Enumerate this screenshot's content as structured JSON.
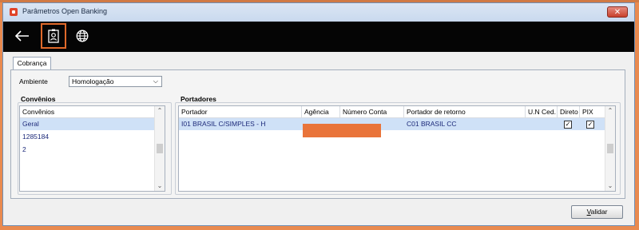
{
  "window": {
    "title": "Parâmetros Open Banking",
    "close_glyph": "✕"
  },
  "toolbar": {
    "buttons": [
      "arrow-left-icon",
      "contact-card-icon",
      "globe-icon"
    ]
  },
  "tabs": [
    {
      "label": "Cobrança"
    }
  ],
  "ambiente": {
    "label": "Ambiente",
    "value": "Homologação"
  },
  "convenios": {
    "group_title": "Convênios",
    "header": "Convênios",
    "items": [
      "Geral",
      "1285184",
      "2"
    ],
    "selected_index": 0
  },
  "portadores": {
    "group_title": "Portadores",
    "columns": [
      "Portador",
      "Agência",
      "Número Conta",
      "Portador de retorno",
      "U.N Ced.",
      "Direto",
      "PIX"
    ],
    "rows": [
      {
        "portador": "I01  BRASIL C/SIMPLES - H",
        "agencia": "",
        "numero_conta": "",
        "portador_retorno": "C01  BRASIL CC",
        "un_ced": "",
        "direto": true,
        "pix": true
      }
    ]
  },
  "validar_button": {
    "label_prefix": "",
    "label_underlined": "V",
    "label_rest": "alidar"
  },
  "colors": {
    "accent": "#e0692a",
    "toolbar_bg": "#050505",
    "selection": "#cfe1f7"
  }
}
